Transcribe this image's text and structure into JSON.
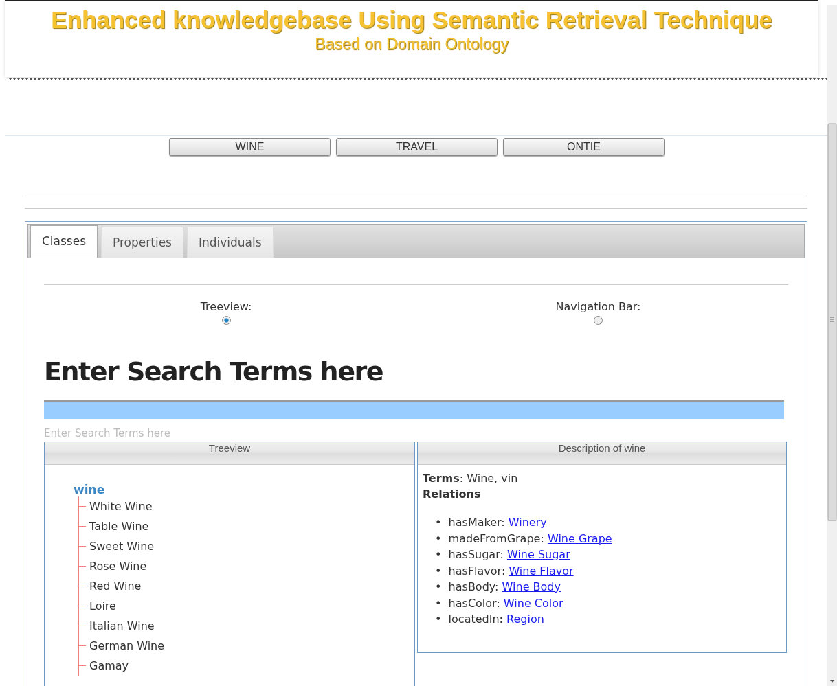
{
  "header": {
    "title": "Enhanced knowledgebase Using Semantic Retrieval Technique",
    "subtitle": "Based on Domain Ontology"
  },
  "nav_buttons": [
    "WINE",
    "TRAVEL",
    "ONTIE"
  ],
  "tabs": [
    {
      "label": "Classes",
      "selected": true
    },
    {
      "label": "Properties",
      "selected": false
    },
    {
      "label": "Individuals",
      "selected": false
    }
  ],
  "view_options": [
    {
      "label": "Treeview:",
      "selected": true
    },
    {
      "label": "Navigation Bar:",
      "selected": false
    }
  ],
  "search": {
    "heading": "Enter Search Terms here",
    "note": "Enter Search Terms here"
  },
  "treeview": {
    "title": "Treeview",
    "root": {
      "label": "wine",
      "children": [
        {
          "label": "White Wine"
        },
        {
          "label": "Table Wine"
        },
        {
          "label": "Sweet Wine"
        },
        {
          "label": "Rose Wine"
        },
        {
          "label": "Red Wine"
        },
        {
          "label": "Loire"
        },
        {
          "label": "Italian Wine"
        },
        {
          "label": "German Wine"
        },
        {
          "label": "Gamay"
        }
      ]
    }
  },
  "description": {
    "title": "Description of wine",
    "terms": "**Terms**: Wine, vin",
    "relations_label": "Relations",
    "relations": [
      {
        "marker": "•",
        "property": "hasMaker:",
        "target": "Winery"
      },
      {
        "marker": "•",
        "property": "madeFromGrape:",
        "target": "Wine Grape"
      },
      {
        "marker": "•",
        "property": "hasSugar:",
        "target": "Wine Sugar"
      },
      {
        "marker": "•",
        "property": "hasFlavor:",
        "target": "Wine Flavor"
      },
      {
        "marker": "•",
        "property": "hasBody:",
        "target": "Wine Body"
      },
      {
        "marker": "•",
        "property": "hasColor:",
        "target": "Wine Color"
      },
      {
        "marker": "•",
        "property": "locatedIn:",
        "target": "Region"
      }
    ]
  }
}
